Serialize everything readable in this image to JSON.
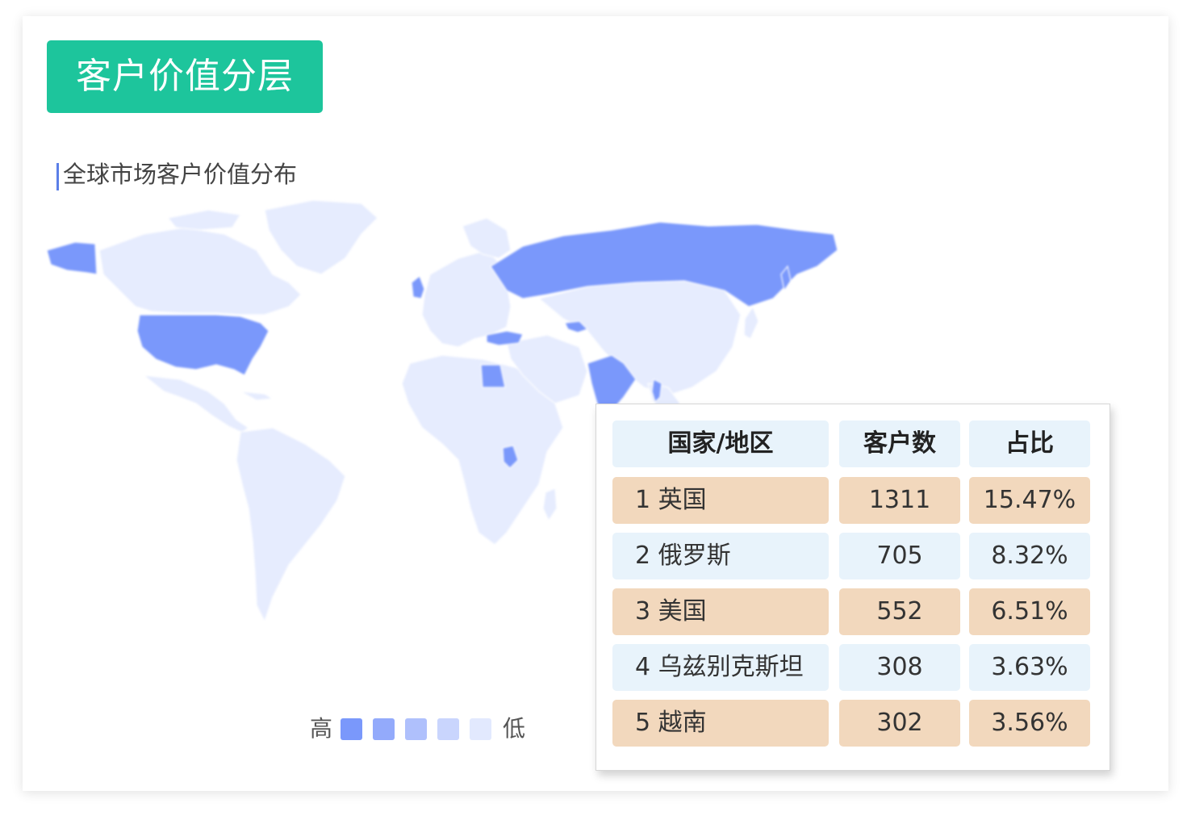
{
  "header": {
    "title": "客户价值分层"
  },
  "map_section": {
    "subtitle": "全球市场客户价值分布",
    "legend": {
      "high_label": "高",
      "low_label": "低",
      "scale_colors": [
        "#7a98fb",
        "#93aafb",
        "#afc0fc",
        "#c9d5fd",
        "#e2e9fe"
      ]
    },
    "colors": {
      "base_country": "#e6ecfe",
      "highlight_country": "#7a98fb",
      "border": "#ffffff"
    },
    "highlighted_regions": [
      "英国",
      "俄罗斯",
      "美国",
      "乌兹别克斯坦",
      "越南"
    ]
  },
  "ranking_table": {
    "headers": [
      "国家/地区",
      "客户数",
      "占比"
    ],
    "rows": [
      {
        "rank": "1",
        "country": "英国",
        "count": "1311",
        "share": "15.47%"
      },
      {
        "rank": "2",
        "country": "俄罗斯",
        "count": "705",
        "share": "8.32%"
      },
      {
        "rank": "3",
        "country": "美国",
        "count": "552",
        "share": "6.51%"
      },
      {
        "rank": "4",
        "country": "乌兹别克斯坦",
        "count": "308",
        "share": "3.63%"
      },
      {
        "rank": "5",
        "country": "越南",
        "count": "302",
        "share": "3.56%"
      }
    ],
    "colors": {
      "header_bg": "#e8f3fb",
      "odd_row_bg": "#f2d8bd",
      "even_row_bg": "#e8f3fb"
    }
  }
}
